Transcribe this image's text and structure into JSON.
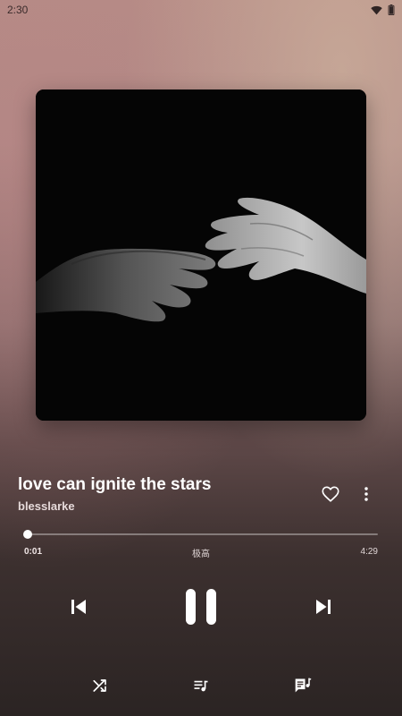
{
  "status_bar": {
    "time": "2:30",
    "icons": [
      "wifi-icon",
      "battery-icon"
    ]
  },
  "track": {
    "title": "love can ignite the stars",
    "artist": "blesslarke",
    "liked": false
  },
  "playback": {
    "elapsed": "0:01",
    "duration": "4:29",
    "progress_fraction": 0.004,
    "quality": "极高",
    "state": "playing"
  },
  "controls": {
    "icons": [
      "skip-previous-icon",
      "pause-icon",
      "skip-next-icon",
      "shuffle-icon",
      "queue-icon",
      "lyrics-icon",
      "heart-outline-icon",
      "more-vertical-icon"
    ]
  },
  "colors": {
    "accent": "#ffffff",
    "track_bg": "rgba(255,255,255,0.35)"
  }
}
